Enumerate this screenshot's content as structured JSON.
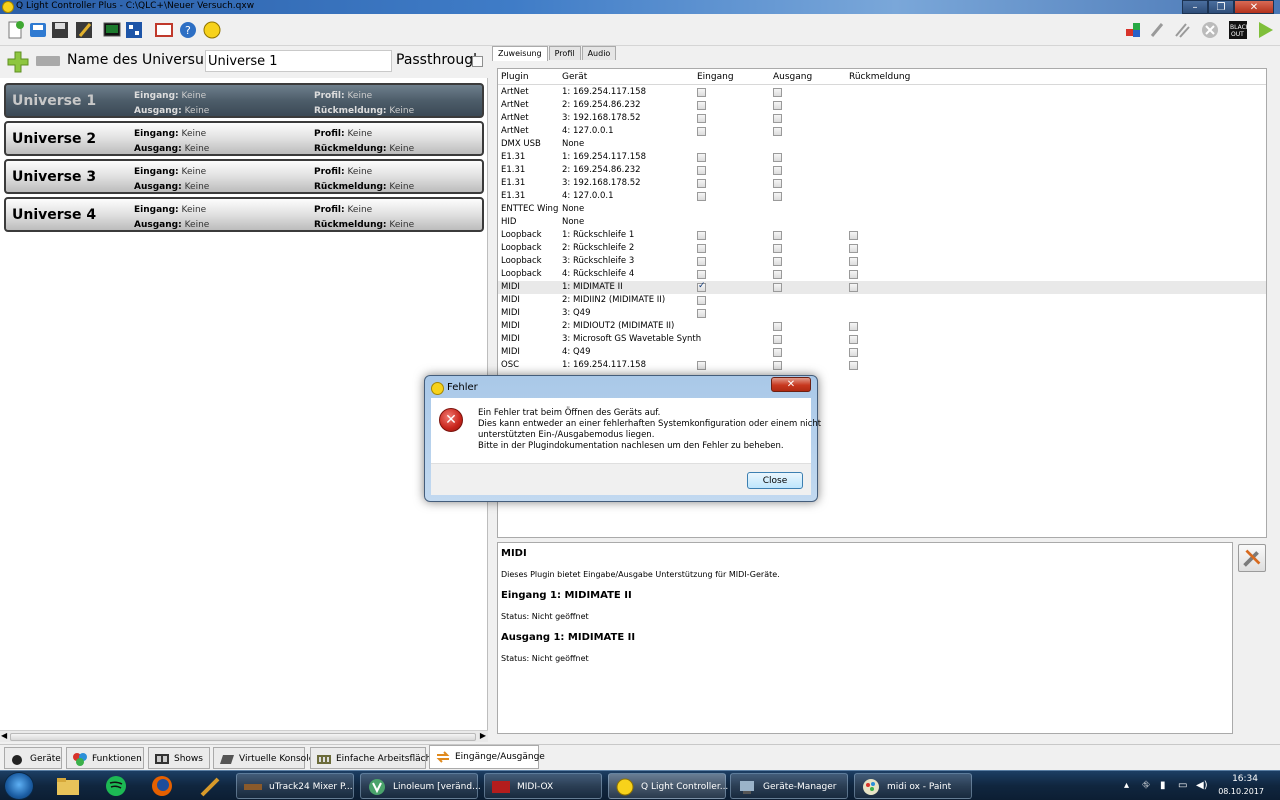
{
  "window": {
    "title": "Q Light Controller Plus - C:\\QLC+\\Neuer Versuch.qxw",
    "min": "–",
    "max": "❐",
    "close": "✕"
  },
  "left": {
    "name_label": "Name des Universums:",
    "name_value": "Universe 1",
    "passthrough_label": "Passthrough",
    "universes": [
      {
        "name": "Universe 1",
        "eingang_label": "Eingang:",
        "eingang": "Keine",
        "ausgang_label": "Ausgang:",
        "ausgang": "Keine",
        "profil_label": "Profil:",
        "profil": "Keine",
        "rueck_label": "Rückmeldung:",
        "rueck": "Keine"
      },
      {
        "name": "Universe 2",
        "eingang_label": "Eingang:",
        "eingang": "Keine",
        "ausgang_label": "Ausgang:",
        "ausgang": "Keine",
        "profil_label": "Profil:",
        "profil": "Keine",
        "rueck_label": "Rückmeldung:",
        "rueck": "Keine"
      },
      {
        "name": "Universe 3",
        "eingang_label": "Eingang:",
        "eingang": "Keine",
        "ausgang_label": "Ausgang:",
        "ausgang": "Keine",
        "profil_label": "Profil:",
        "profil": "Keine",
        "rueck_label": "Rückmeldung:",
        "rueck": "Keine"
      },
      {
        "name": "Universe 4",
        "eingang_label": "Eingang:",
        "eingang": "Keine",
        "ausgang_label": "Ausgang:",
        "ausgang": "Keine",
        "profil_label": "Profil:",
        "profil": "Keine",
        "rueck_label": "Rückmeldung:",
        "rueck": "Keine"
      }
    ]
  },
  "right": {
    "tabs": [
      "Zuweisung",
      "Profil",
      "Audio"
    ],
    "columns": [
      "Plugin",
      "Gerät",
      "Eingang",
      "Ausgang",
      "Rückmeldung"
    ],
    "rows": [
      {
        "plugin": "ArtNet",
        "device": "1: 169.254.117.158",
        "in": "off",
        "out": "off",
        "fb": ""
      },
      {
        "plugin": "ArtNet",
        "device": "2: 169.254.86.232",
        "in": "off",
        "out": "off",
        "fb": ""
      },
      {
        "plugin": "ArtNet",
        "device": "3: 192.168.178.52",
        "in": "off",
        "out": "off",
        "fb": ""
      },
      {
        "plugin": "ArtNet",
        "device": "4: 127.0.0.1",
        "in": "off",
        "out": "off",
        "fb": ""
      },
      {
        "plugin": "DMX USB",
        "device": "None",
        "in": "",
        "out": "",
        "fb": ""
      },
      {
        "plugin": "E1.31",
        "device": "1: 169.254.117.158",
        "in": "off",
        "out": "off",
        "fb": ""
      },
      {
        "plugin": "E1.31",
        "device": "2: 169.254.86.232",
        "in": "off",
        "out": "off",
        "fb": ""
      },
      {
        "plugin": "E1.31",
        "device": "3: 192.168.178.52",
        "in": "off",
        "out": "off",
        "fb": ""
      },
      {
        "plugin": "E1.31",
        "device": "4: 127.0.0.1",
        "in": "off",
        "out": "off",
        "fb": ""
      },
      {
        "plugin": "ENTTEC Wing",
        "device": "None",
        "in": "",
        "out": "",
        "fb": ""
      },
      {
        "plugin": "HID",
        "device": "None",
        "in": "",
        "out": "",
        "fb": ""
      },
      {
        "plugin": "Loopback",
        "device": "1: Rückschleife 1",
        "in": "off",
        "out": "off",
        "fb": "off"
      },
      {
        "plugin": "Loopback",
        "device": "2: Rückschleife 2",
        "in": "off",
        "out": "off",
        "fb": "off"
      },
      {
        "plugin": "Loopback",
        "device": "3: Rückschleife 3",
        "in": "off",
        "out": "off",
        "fb": "off"
      },
      {
        "plugin": "Loopback",
        "device": "4: Rückschleife 4",
        "in": "off",
        "out": "off",
        "fb": "off"
      },
      {
        "plugin": "MIDI",
        "device": "1: MIDIMATE II",
        "in": "on",
        "out": "off",
        "fb": "off",
        "highlight": true
      },
      {
        "plugin": "MIDI",
        "device": "2: MIDIIN2 (MIDIMATE II)",
        "in": "off",
        "out": "",
        "fb": ""
      },
      {
        "plugin": "MIDI",
        "device": "3: Q49",
        "in": "off",
        "out": "",
        "fb": ""
      },
      {
        "plugin": "MIDI",
        "device": "2: MIDIOUT2 (MIDIMATE II)",
        "in": "",
        "out": "off",
        "fb": "off"
      },
      {
        "plugin": "MIDI",
        "device": "3: Microsoft GS Wavetable Synth",
        "in": "",
        "out": "off",
        "fb": "off"
      },
      {
        "plugin": "MIDI",
        "device": "4: Q49",
        "in": "",
        "out": "off",
        "fb": "off"
      },
      {
        "plugin": "OSC",
        "device": "1: 169.254.117.158",
        "in": "off",
        "out": "off",
        "fb": "off"
      }
    ],
    "info": {
      "title": "MIDI",
      "desc": "Dieses Plugin bietet Eingabe/Ausgabe Unterstützung für MIDI-Geräte.",
      "in_title": "Eingang 1: MIDIMATE II",
      "in_status": "Status: Nicht geöffnet",
      "out_title": "Ausgang 1: MIDIMATE II",
      "out_status": "Status: Nicht geöffnet"
    }
  },
  "bottom_tabs": [
    "Geräte",
    "Funktionen",
    "Shows",
    "Virtuelle Konsole",
    "Einfache Arbeitsfläche",
    "Eingänge/Ausgänge"
  ],
  "dialog": {
    "title": "Fehler",
    "close_glyph": "✕",
    "lines": [
      "Ein Fehler trat beim Öffnen des Geräts auf.",
      "Dies kann entweder an einer fehlerhaften Systemkonfiguration oder einem nicht",
      "unterstützten Ein-/Ausgabemodus liegen.",
      "Bitte in der Plugindokumentation nachlesen um den Fehler zu beheben."
    ],
    "button": "Close"
  },
  "taskbar": {
    "tasks": [
      "uTrack24 Mixer P...",
      "Linoleum [veränd...",
      "MIDI-OX",
      "Q Light Controller...",
      "Geräte-Manager",
      "midi ox - Paint"
    ],
    "time": "16:34",
    "date": "08.10.2017"
  },
  "colors": {
    "accent": "#3f7cc7",
    "error": "#c8241b",
    "selected_universe": "#4d5d6a"
  }
}
